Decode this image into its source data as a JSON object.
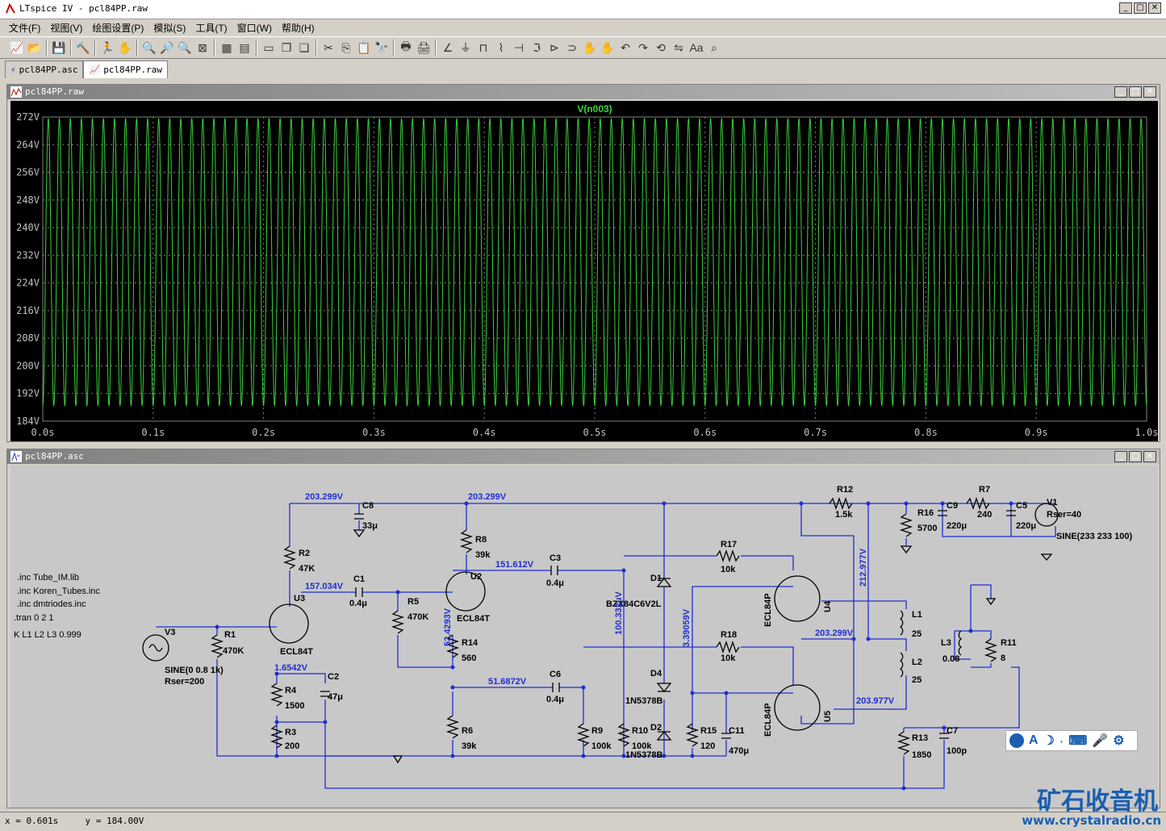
{
  "app": {
    "title": "LTspice IV - pcl84PP.raw"
  },
  "menu": [
    "文件(F)",
    "视图(V)",
    "绘图设置(P)",
    "模拟(S)",
    "工具(T)",
    "窗口(W)",
    "帮助(H)"
  ],
  "tabs": [
    {
      "label": "pcl84PP.asc"
    },
    {
      "label": "pcl84PP.raw"
    }
  ],
  "plot": {
    "window_title": "pcl84PP.raw"
  },
  "schematic": {
    "window_title": "pcl84PP.asc",
    "directives": [
      ".inc Tube_IM.lib",
      ".inc Koren_Tubes.inc",
      ".inc dmtriodes.inc",
      ".tran 0 2 1",
      "K L1 L2 L3 0.999"
    ],
    "voltages": [
      "203.299V",
      "203.299V",
      "157.034V",
      "151.612V",
      "52.4293V",
      "1.6542V",
      "51.6872V",
      "100.332μV",
      "3.39059V",
      "212.977V",
      "203.299V",
      "203.977V"
    ],
    "labels": [
      "R12",
      "1.5k",
      "R16",
      "5700",
      "C9",
      "220μ",
      "R7",
      "240",
      "C5",
      "220μ",
      "V1",
      "Rser=40",
      "SINE(233 233 100)",
      "C8",
      "33μ",
      "R8",
      "39k",
      "R2",
      "47K",
      "U2",
      "C3",
      "0.4μ",
      "R17",
      "10k",
      "D1",
      "BZX84C6V2L",
      "ECL84P",
      "U4",
      "L1",
      "25",
      "L2",
      "25",
      "L3",
      "0.08",
      "R11",
      "8",
      "C1",
      "0.4μ",
      "U3",
      "R5",
      "470K",
      "ECL84T",
      "V3",
      "R1",
      "470K",
      "ECL84T",
      "SINE(0 0.8 1k)",
      "Rser=200",
      "C2",
      "47μ",
      "R4",
      "1500",
      "R3",
      "200",
      "R14",
      "560",
      "C6",
      "0.4μ",
      "R6",
      "39k",
      "R9",
      "100k",
      "R10",
      "100k",
      "D4",
      "1N5378B",
      "D2",
      "1N5378B",
      "R18",
      "10k",
      "ECL84P",
      "U5",
      "R15",
      "120",
      "C11",
      "470μ",
      "R13",
      "1850",
      "C7",
      "100p"
    ]
  },
  "status": {
    "x": "x = 0.601s",
    "y": "y = 184.00V"
  },
  "watermark": {
    "cn": "矿石收音机",
    "url": "www.crystalradio.cn"
  },
  "colors": {
    "trace": "#3ad13a",
    "wire": "#1f2fd0",
    "component": "#000000",
    "plot_bg": "#000000"
  },
  "chart_data": {
    "type": "line",
    "title": "V(n003)",
    "xlabel": "",
    "ylabel": "",
    "x_ticks": [
      "0.0s",
      "0.1s",
      "0.2s",
      "0.3s",
      "0.4s",
      "0.5s",
      "0.6s",
      "0.7s",
      "0.8s",
      "0.9s",
      "1.0s"
    ],
    "y_ticks": [
      "272V",
      "264V",
      "256V",
      "248V",
      "240V",
      "232V",
      "224V",
      "216V",
      "208V",
      "200V",
      "192V",
      "184V"
    ],
    "xlim": [
      0,
      1
    ],
    "ylim": [
      184,
      272
    ],
    "series": [
      {
        "name": "V(n003)",
        "frequency_hz": 100,
        "min": 188.5,
        "max": 271.5
      }
    ]
  }
}
